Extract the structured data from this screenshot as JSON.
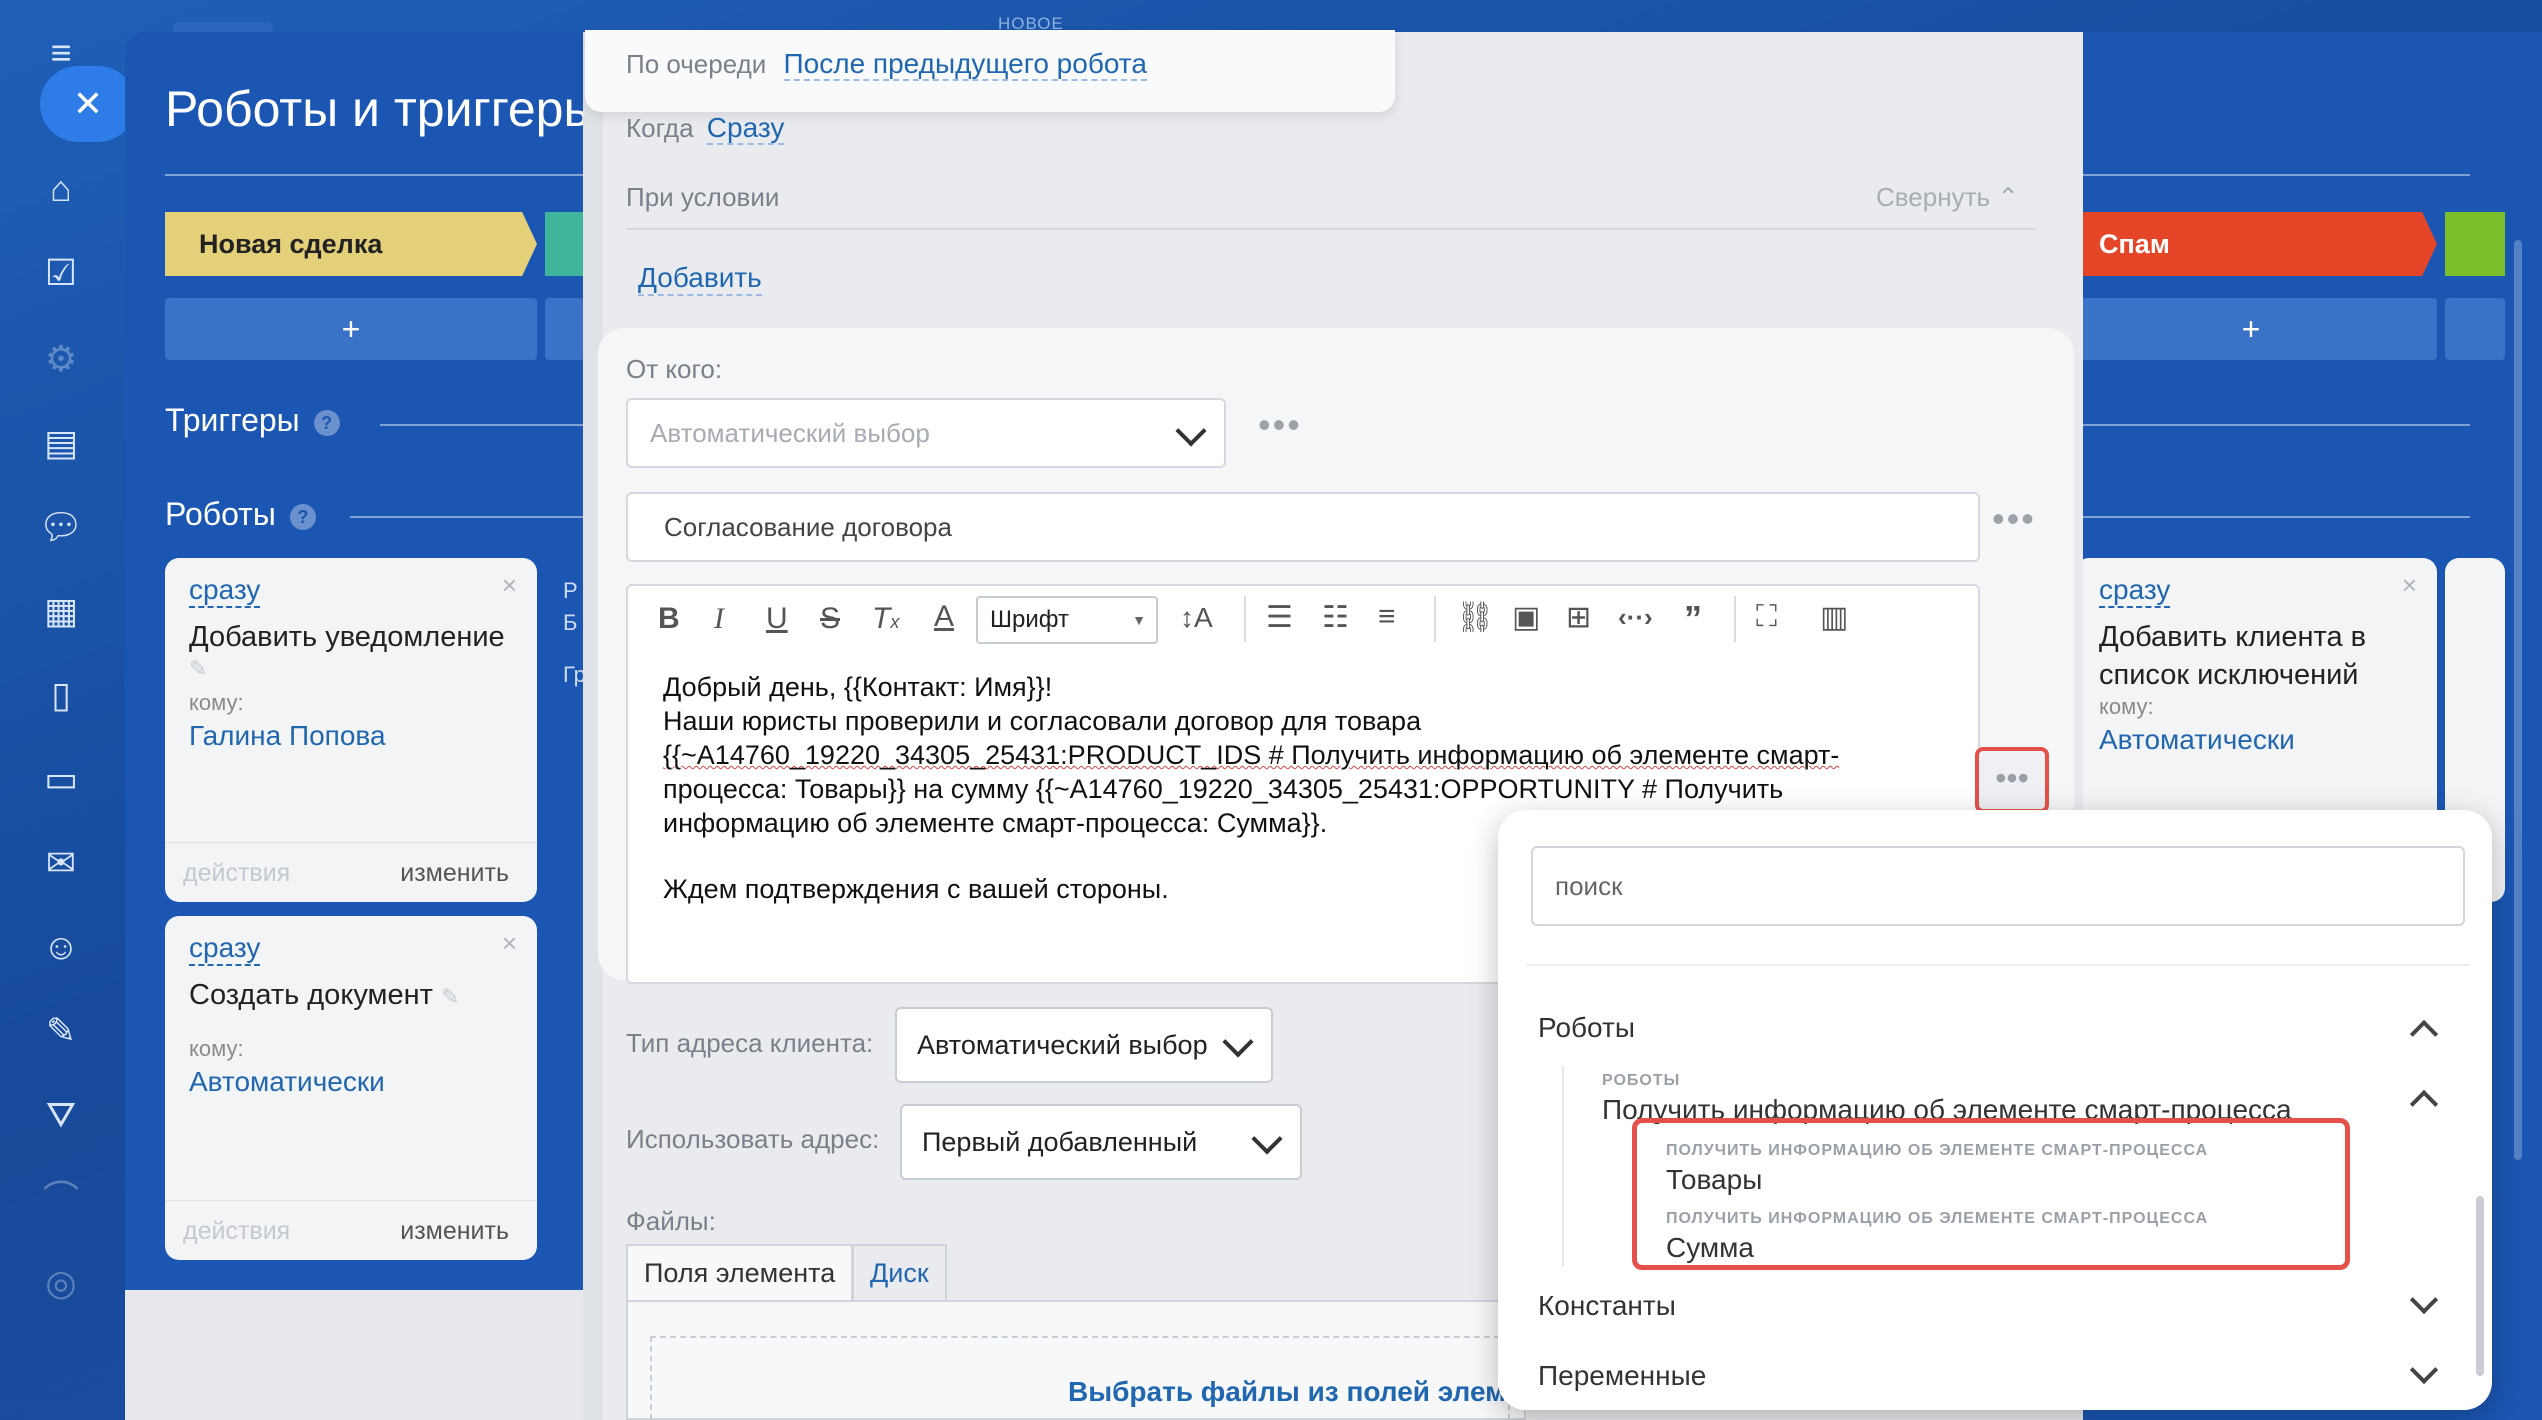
{
  "top_badge": "НОВОЕ",
  "background": {
    "title": "Роботы и триггеры",
    "stages": [
      {
        "label": "Новая сделка",
        "color": "#e5d07a"
      },
      {
        "label": "Спам",
        "color": "#e64628"
      }
    ],
    "add_label": "+",
    "triggers_label": "Триггеры",
    "robots_label": "Роботы",
    "help": "?",
    "cards": [
      {
        "when": "сразу",
        "title": "Добавить уведомление",
        "to_label": "кому:",
        "to": "Галина Попова",
        "actions": "действия",
        "edit": "изменить"
      },
      {
        "when": "сразу",
        "title": "Создать документ",
        "to_label": "кому:",
        "to": "Автоматически",
        "actions": "действия",
        "edit": "изменить"
      },
      {
        "when": "сразу",
        "title": "Добавить клиента в список исключений",
        "to_label": "кому:",
        "to": "Автоматически"
      }
    ],
    "partial_letters": [
      "Р",
      "Б",
      "Гр"
    ]
  },
  "dialog": {
    "queue_label": "По очереди",
    "queue_value": "После предыдущего робота",
    "when_label": "Когда",
    "when_value": "Сразу",
    "condition_label": "При условии",
    "collapse_label": "Свернуть",
    "add_condition": "Добавить",
    "from_label": "От кого:",
    "from_placeholder": "Автоматический выбор",
    "subject_value": "Согласование договора",
    "font_select": "Шрифт",
    "body_lines": [
      "Добрый день, {{Контакт: Имя}}!",
      "Наши юристы проверили и согласовали договор для товара",
      "{{~A14760_19220_34305_25431:PRODUCT_IDS # Получить информацию об элементе смарт-",
      "процесса: Товары}} на сумму {{~A14760_19220_34305_25431:OPPORTUNITY # Получить",
      "информацию об элементе смарт-процесса: Сумма}}.",
      "",
      "Ждем подтверждения с вашей стороны."
    ],
    "address_type_label": "Тип адреса клиента:",
    "address_type_value": "Автоматический выбор",
    "use_address_label": "Использовать адрес:",
    "use_address_value": "Первый добавленный",
    "files_label": "Файлы:",
    "tabs": [
      "Поля элемента",
      "Диск"
    ],
    "choose_files": "Выбрать файлы из полей элем"
  },
  "popup": {
    "search_placeholder": "поиск",
    "group_robots": "Роботы",
    "sub_caption": "РОБОТЫ",
    "sub_title": "Получить информацию об элементе смарт-процесса",
    "items": [
      {
        "caption": "ПОЛУЧИТЬ ИНФОРМАЦИЮ ОБ ЭЛЕМЕНТЕ СМАРТ-ПРОЦЕССА",
        "label": "Товары"
      },
      {
        "caption": "ПОЛУЧИТЬ ИНФОРМАЦИЮ ОБ ЭЛЕМЕНТЕ СМАРТ-ПРОЦЕССА",
        "label": "Сумма"
      }
    ],
    "group_constants": "Константы",
    "group_variables": "Переменные"
  },
  "colors": {
    "accent": "#2067b0",
    "highlight": "#e5514a",
    "brand_bg": "#1b56b3"
  }
}
